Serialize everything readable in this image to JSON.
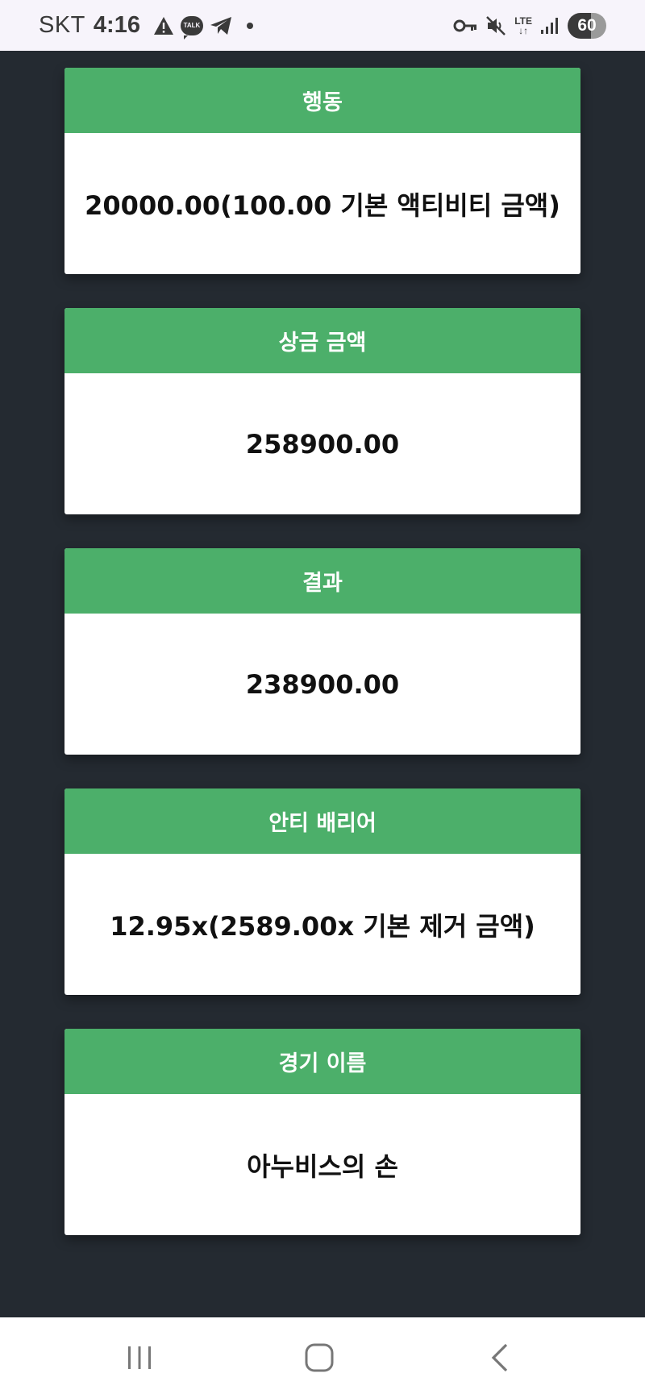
{
  "status_bar": {
    "carrier": "SKT",
    "time": "4:16",
    "notification_talk": "TALK",
    "battery": "60"
  },
  "cards": [
    {
      "header": "행동",
      "value": "20000.00(100.00 기본 액티비티 금액)"
    },
    {
      "header": "상금 금액",
      "value": "258900.00"
    },
    {
      "header": "결과",
      "value": "238900.00"
    },
    {
      "header": "안티 배리어",
      "value": "12.95x(2589.00x 기본 제거 금액)"
    },
    {
      "header": "경기 이름",
      "value": "아누비스의 손"
    }
  ],
  "nav_bar": {
    "icons": [
      "recent-apps-icon",
      "home-icon",
      "back-icon"
    ]
  },
  "colors": {
    "background": "#242a31",
    "card_header": "#4caf6a",
    "card_body": "#ffffff",
    "status_bar": "#f7f4fb"
  }
}
